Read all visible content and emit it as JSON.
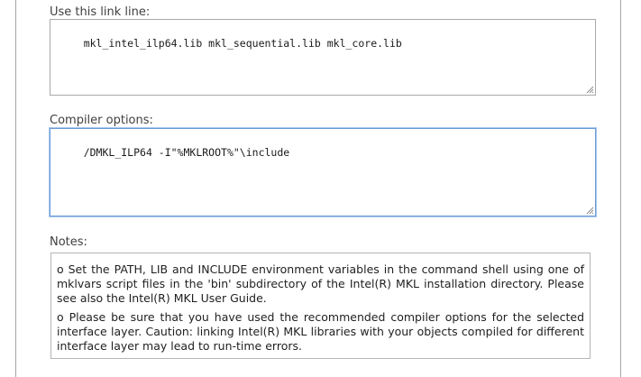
{
  "link_line": {
    "label": "Use this link line:",
    "value": "mkl_intel_ilp64.lib mkl_sequential.lib mkl_core.lib"
  },
  "compiler_options": {
    "label": "Compiler options:",
    "value": "/DMKL_ILP64 -I\"%MKLROOT%\"\\include"
  },
  "notes": {
    "label": "Notes:",
    "items": [
      "o Set the PATH, LIB and INCLUDE environment variables in the command shell using one of mklvars script files in the 'bin' subdirectory of the Intel(R) MKL installation directory. Please see also the Intel(R) MKL User Guide.",
      "o Please be sure that you have used the recommended compiler options for the selected interface layer. Caution: linking Intel(R) MKL libraries with your objects compiled for different interface layer may lead to run-time errors."
    ]
  },
  "colors": {
    "panel_border": "#a6a6a6",
    "focus_border": "#6d9bd8",
    "label_text": "#3f3f3f"
  },
  "icons": {
    "resize_grip": "resize-grip-icon"
  }
}
